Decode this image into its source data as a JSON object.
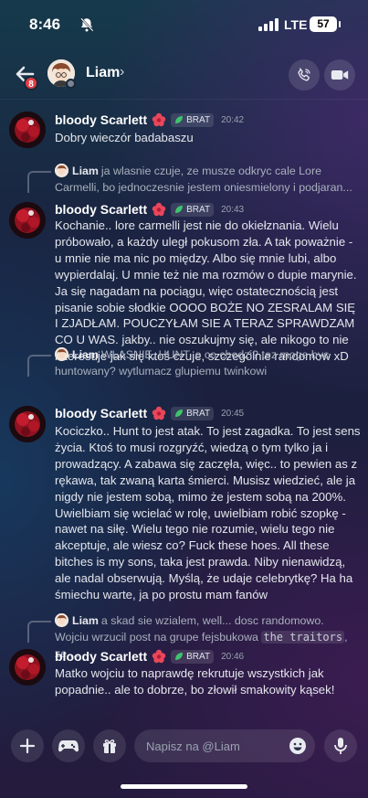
{
  "status_bar": {
    "time": "8:46",
    "network": "LTE",
    "battery": "57"
  },
  "header": {
    "back_badge": "8",
    "contact_name": "Liam",
    "chevron": "›"
  },
  "messages": [
    {
      "author": "bloody Scarlett",
      "tag": "BRAT",
      "time": "20:42",
      "text": "Dobry wieczór badabaszu"
    },
    {
      "reply": {
        "author": "Liam",
        "text": "ja wlasnie czuje, ze musze odkryc cale Lore Carmelli, bo jednoczesnie jestem oniesmielony i podjaran..."
      },
      "author": "bloody Scarlett",
      "tag": "BRAT",
      "time": "20:43",
      "text": "Kochanie.. lore carmelli jest nie do okiełznania. Wielu próbowało, a każdy uległ pokusom zła. A tak poważnie - u mnie nie ma nic po między. Albo się mnie lubi, albo wypierdalaj. U mnie też nie ma rozmów o dupie marynie. Ja się nagadam na pociągu, więc ostatecznością jest pisanie sobie słodkie OOOO BOŻE NO ZESRALAM SIĘ I ZJADŁAM. POUCZYŁAM SIE A TERAZ SPRAWDZAM CO U WAS. jakby.. nie oszukujmy się, ale nikogo to nie interesuje jak się ktoś czuje, szczególnie randomow xD"
    },
    {
      "reply": {
        "author": "Liam",
        "text": "WLASNIE, HUNT. o co chodzi? tez moge byc huntowany? wytlumacz glupiemu twinkowi"
      },
      "author": "bloody Scarlett",
      "tag": "BRAT",
      "time": "20:45",
      "text": "Kociczko.. Hunt to jest atak. To jest zagadka. To jest sens życia. Ktoś to musi rozgryźć, wiedzą o tym tylko ja i prowadzący. A zabawa się zaczęła, więc.. to pewien as z rękawa, tak zwaną karta śmierci. Musisz wiedzieć, ale ja nigdy nie jestem sobą, mimo że jestem sobą na 200%. Uwielbiam się wcielać w rolę, uwielbiam robić szopkę - nawet na siłę. Wielu tego nie rozumie, wielu tego nie akceptuje, ale wiesz co? Fuck these hoes. All these bitches is my sons, taka jest prawda. Niby nienawidzą, ale nadal obserwują. Myślą, że udaje celebrytkę? Ha ha śmiechu warte, ja po prostu mam fanów"
    },
    {
      "reply": {
        "author": "Liam",
        "text_before": "a skad sie wzialem, well... dosc randomowo. Wojciu wrzucil post na grupe fejsbukowa ",
        "code": "the traitors",
        "text_after": ", ze ..."
      },
      "author": "bloody Scarlett",
      "tag": "BRAT",
      "time": "20:46",
      "text": "Matko wojciu to naprawdę rekrutuje wszystkich jak popadnie.. ale to dobrze, bo złowił smakowity kąsek!"
    }
  ],
  "composer": {
    "placeholder": "Napisz na @Liam"
  },
  "colors": {
    "badge": "#e33d45",
    "tag_leaf": "#3ec46d"
  }
}
